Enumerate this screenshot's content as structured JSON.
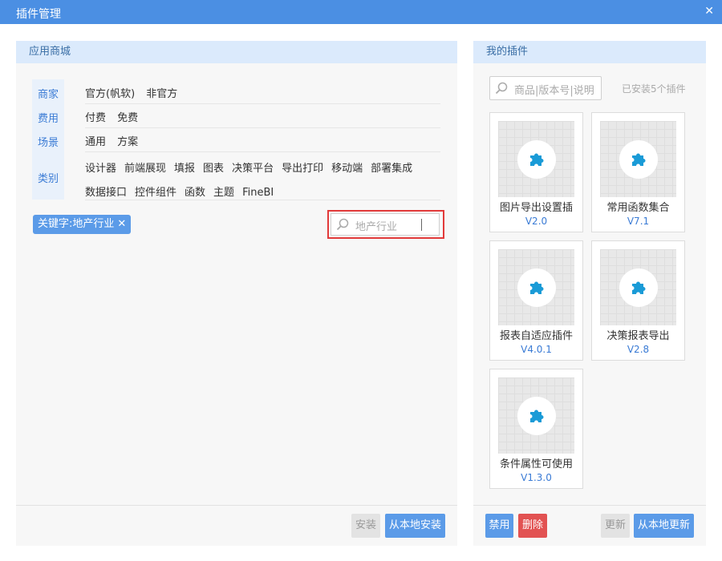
{
  "window": {
    "title": "插件管理",
    "close_label": "✕"
  },
  "store": {
    "title": "应用商城",
    "filters": [
      {
        "label": "商家",
        "options": [
          "官方(帆软)",
          "非官方"
        ]
      },
      {
        "label": "费用",
        "options": [
          "付费",
          "免费"
        ]
      },
      {
        "label": "场景",
        "options": [
          "通用",
          "方案"
        ]
      },
      {
        "label": "类别",
        "options": [
          "设计器",
          "前端展现",
          "填报",
          "图表",
          "决策平台",
          "导出打印",
          "移动端",
          "部署集成",
          "数据接口",
          "控件组件",
          "函数",
          "主题",
          "FineBI"
        ]
      }
    ],
    "keyword_chip": "关键字:地产行业",
    "chip_remove": "✕",
    "search_value": "地产行业",
    "install_button": "安装",
    "install_local_button": "从本地安装"
  },
  "my_plugins": {
    "title": "我的插件",
    "search_placeholder": "商品|版本号|说明",
    "installed_count": "已安装5个插件",
    "plugins": [
      {
        "name": "图片导出设置插",
        "version": "V2.0"
      },
      {
        "name": "常用函数集合",
        "version": "V7.1"
      },
      {
        "name": "报表自适应插件",
        "version": "V4.0.1"
      },
      {
        "name": "决策报表导出",
        "version": "V2.8"
      },
      {
        "name": "条件属性可使用",
        "version": "V1.3.0"
      }
    ],
    "disable_button": "禁用",
    "delete_button": "删除",
    "update_button": "更新",
    "update_local_button": "从本地更新"
  },
  "colors": {
    "titlebar": "#4b8fe3",
    "accent": "#5b9be8",
    "danger": "#e25252",
    "puzzle": "#1a9bd7",
    "highlight": "#e23a3a"
  },
  "icons": {
    "search": "magnifier-icon",
    "plugin": "puzzle-icon",
    "close": "close-icon"
  }
}
